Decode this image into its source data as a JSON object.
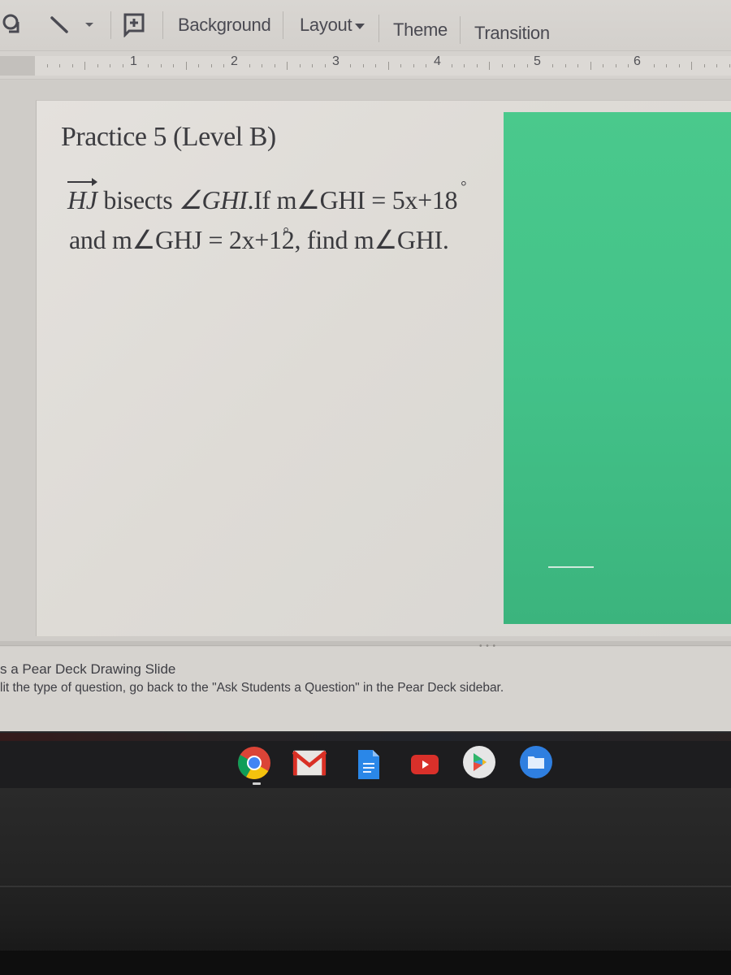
{
  "toolbar": {
    "shape_tool_icon": "shape-icon",
    "line_tool_icon": "line-icon",
    "line_dropdown_icon": "caret-down-icon",
    "comment_icon": "add-comment-icon",
    "background_label": "Background",
    "layout_label": "Layout",
    "theme_label": "Theme",
    "transition_label": "Transition"
  },
  "ruler": {
    "numbers": [
      "1",
      "2",
      "3",
      "4",
      "5",
      "6"
    ]
  },
  "slide": {
    "title": "Practice 5 (Level B)",
    "line1": {
      "ray": "HJ",
      "text_a": " bisects ",
      "angle_symbol": "∠",
      "angle_name": "GHI",
      "text_b": ".If m∠GHI = 5x+18",
      "degree": "°"
    },
    "line2": {
      "text_a": "and m∠GHJ = 2x+12",
      "degree": "°",
      "text_b": ", find m∠GHI."
    },
    "panel_color": "#45c48a"
  },
  "notes": {
    "handle": "• • •",
    "line1": "s a Pear Deck Drawing Slide",
    "line2": "lit the type of question, go back to the \"Ask Students a Question\" in the Pear Deck sidebar."
  },
  "shelf": {
    "apps": [
      {
        "name": "Chrome",
        "icon": "chrome-icon"
      },
      {
        "name": "Gmail",
        "icon": "gmail-icon"
      },
      {
        "name": "Docs",
        "icon": "docs-icon"
      },
      {
        "name": "YouTube",
        "icon": "youtube-icon"
      },
      {
        "name": "Play Store",
        "icon": "play-store-icon"
      },
      {
        "name": "Files",
        "icon": "files-icon"
      }
    ]
  }
}
